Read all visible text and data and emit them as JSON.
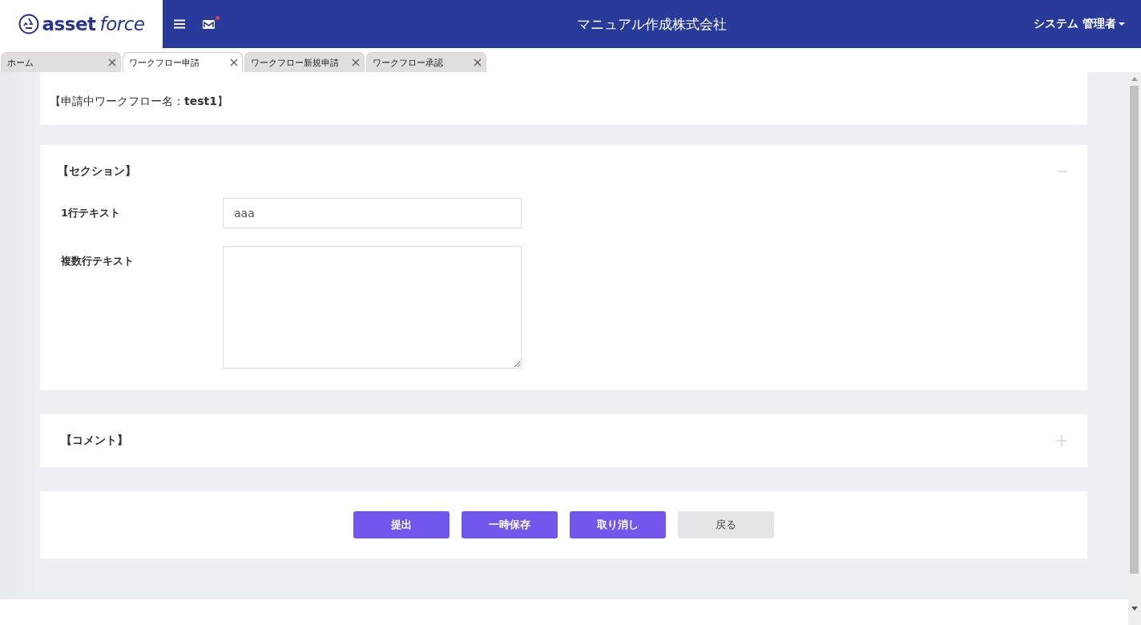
{
  "header": {
    "logo": {
      "bold": "asset",
      "light": "force"
    },
    "mail_unread": true,
    "company": "マニュアル作成株式会社",
    "user": "システム 管理者"
  },
  "tabs": [
    {
      "label": "ホーム",
      "selected": false
    },
    {
      "label": "ワークフロー申請",
      "selected": true
    },
    {
      "label": "ワークフロー新規申請",
      "selected": false
    },
    {
      "label": "ワークフロー承認",
      "selected": false
    }
  ],
  "workflow_title": "【申請中ワークフロー名：**test1**】",
  "sections": [
    {
      "title": "【セクション】",
      "expanded": true,
      "fields": [
        {
          "kind": "text",
          "label": "1行テキスト",
          "value": "aaa"
        },
        {
          "kind": "textarea",
          "label": "複数行テキスト"
        }
      ]
    },
    {
      "title": "【コメント】",
      "expanded": false
    }
  ],
  "buttons": [
    {
      "label": "提出",
      "kind": "primary"
    },
    {
      "label": "一時保存",
      "kind": "primary"
    },
    {
      "label": "取り消し",
      "kind": "primary"
    },
    {
      "label": "戻る",
      "kind": "secondary"
    }
  ]
}
